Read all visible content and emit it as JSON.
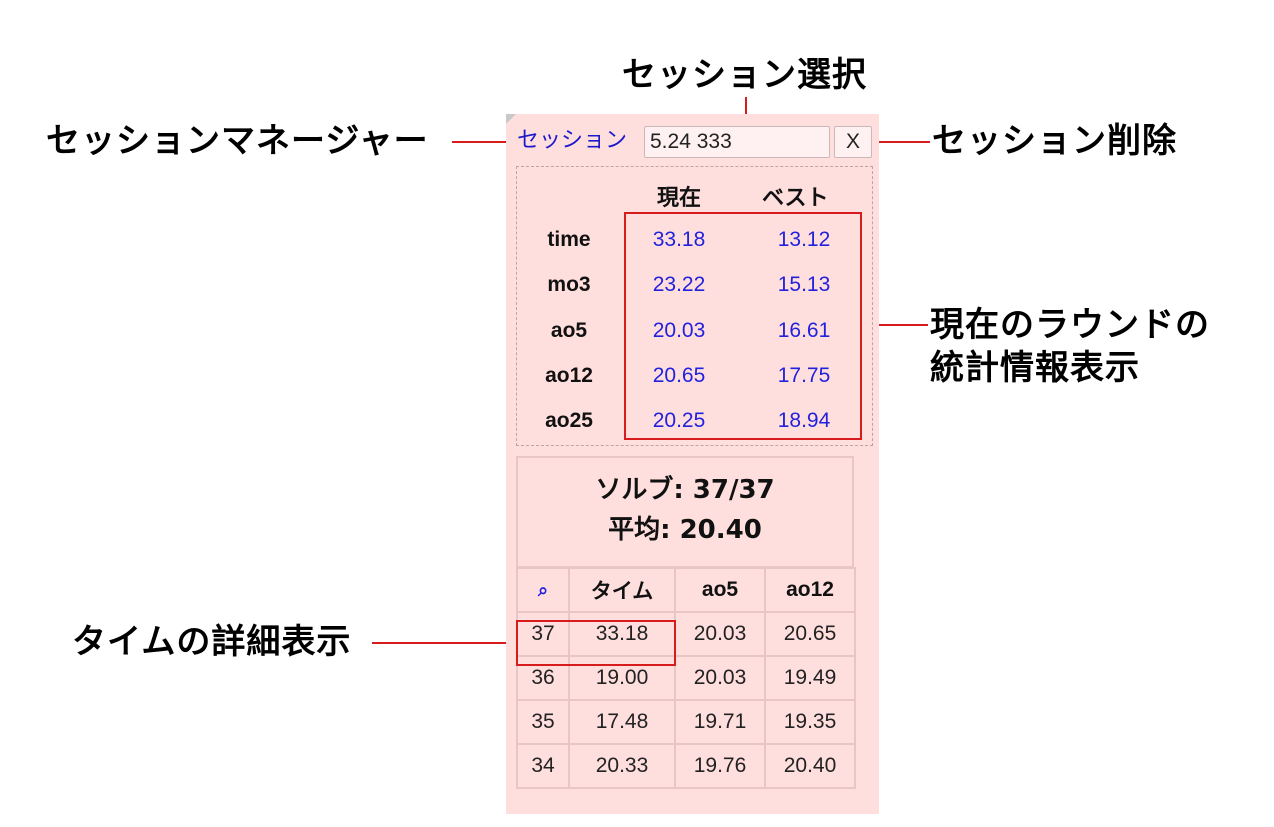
{
  "callouts": {
    "session_select": "セッション選択",
    "session_manager": "セッションマネージャー",
    "session_delete": "セッション削除",
    "round_stats_line1": "現在のラウンドの",
    "round_stats_line2": "統計情報表示",
    "time_detail": "タイムの詳細表示"
  },
  "session": {
    "link_label": "セッション",
    "selected": "5.24 333",
    "delete_label": "X"
  },
  "stats": {
    "headers": {
      "current": "現在",
      "best": "ベスト"
    },
    "rows": [
      {
        "label": "time",
        "current": "33.18",
        "best": "13.12"
      },
      {
        "label": "mo3",
        "current": "23.22",
        "best": "15.13"
      },
      {
        "label": "ao5",
        "current": "20.03",
        "best": "16.61"
      },
      {
        "label": "ao12",
        "current": "20.65",
        "best": "17.75"
      },
      {
        "label": "ao25",
        "current": "20.25",
        "best": "18.94"
      }
    ]
  },
  "summary": {
    "solves": "ソルブ: 37/37",
    "average": "平均: 20.40"
  },
  "times_table": {
    "headers": {
      "search": "⌕",
      "time": "タイム",
      "ao5": "ao5",
      "ao12": "ao12"
    },
    "rows": [
      {
        "n": "37",
        "time": "33.18",
        "ao5": "20.03",
        "ao12": "20.65"
      },
      {
        "n": "36",
        "time": "19.00",
        "ao5": "20.03",
        "ao12": "19.49"
      },
      {
        "n": "35",
        "time": "17.48",
        "ao5": "19.71",
        "ao12": "19.35"
      },
      {
        "n": "34",
        "time": "20.33",
        "ao5": "19.76",
        "ao12": "20.40"
      }
    ]
  },
  "colors": {
    "panel_bg": "#ffdede",
    "annotation": "#d81b1b",
    "link": "#1a1acc",
    "stat_value": "#2222dd"
  }
}
